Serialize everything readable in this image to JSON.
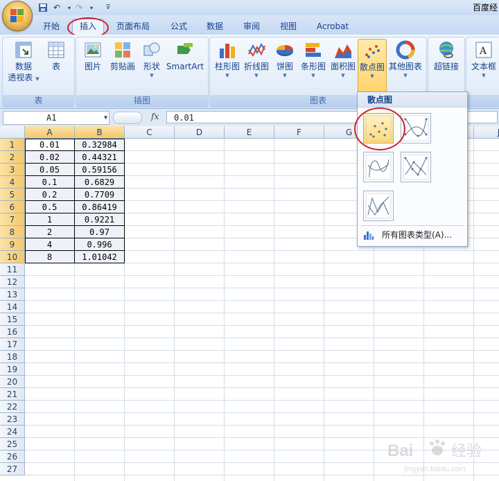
{
  "title_bar": {
    "text": "百度经"
  },
  "tabs": [
    {
      "label": "开始"
    },
    {
      "label": "插入"
    },
    {
      "label": "页面布局"
    },
    {
      "label": "公式"
    },
    {
      "label": "数据"
    },
    {
      "label": "审阅"
    },
    {
      "label": "视图"
    },
    {
      "label": "Acrobat"
    }
  ],
  "ribbon": {
    "groups": {
      "tables": "表",
      "illustrations": "插图",
      "charts": "图表"
    },
    "buttons": {
      "pivot_line1": "数据",
      "pivot_line2": "透视表",
      "table": "表",
      "picture": "图片",
      "clipart": "剪贴画",
      "shapes": "形状",
      "smartart": "SmartArt",
      "column": "柱形图",
      "line": "折线图",
      "pie": "饼图",
      "bar": "条形图",
      "area": "面积图",
      "scatter": "散点图",
      "other": "其他图表",
      "hyperlink": "超链接",
      "textbox": "文本框"
    }
  },
  "formula_bar": {
    "name_box": "A1",
    "fx": "fx",
    "value": "0.01"
  },
  "grid": {
    "columns": [
      "A",
      "B",
      "C",
      "D",
      "E",
      "F",
      "G",
      "H",
      "I",
      "J"
    ],
    "rows": [
      "1",
      "2",
      "3",
      "4",
      "5",
      "6",
      "7",
      "8",
      "9",
      "10",
      "11",
      "12",
      "13",
      "14",
      "15",
      "16",
      "17",
      "18",
      "19",
      "20",
      "21",
      "22",
      "23",
      "24",
      "25",
      "26",
      "27"
    ],
    "data": [
      [
        "0.01",
        "0.32984"
      ],
      [
        "0.02",
        "0.44321"
      ],
      [
        "0.05",
        "0.59156"
      ],
      [
        "0.1",
        "0.6829"
      ],
      [
        "0.2",
        "0.7709"
      ],
      [
        "0.5",
        "0.86419"
      ],
      [
        "1",
        "0.9221"
      ],
      [
        "2",
        "0.97"
      ],
      [
        "4",
        "0.996"
      ],
      [
        "8",
        "1.01042"
      ]
    ]
  },
  "dropdown": {
    "title": "散点图",
    "all_types": "所有图表类型(A)..."
  },
  "watermark": {
    "text1": "Bai",
    "text2": "经验",
    "url": "jingyan.baidu.com"
  },
  "colors": {
    "accent_red": "#d0202a",
    "ribbon_blue": "#15428b",
    "highlight": "#ffd36b"
  }
}
